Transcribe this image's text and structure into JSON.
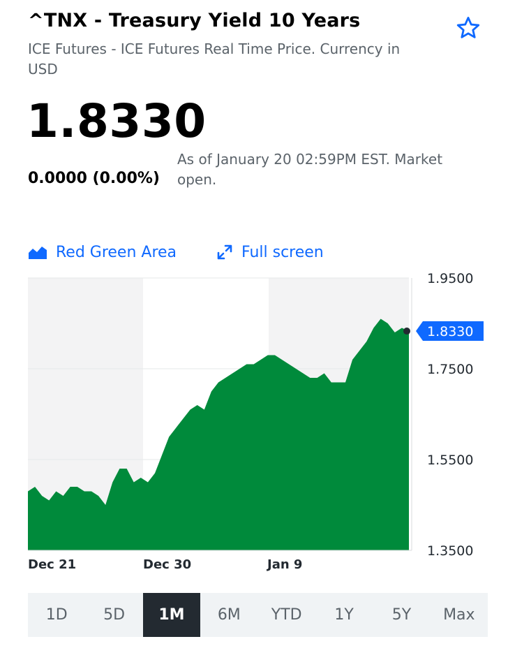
{
  "header": {
    "title": "^TNX - Treasury Yield 10 Years",
    "subtitle": "ICE Futures - ICE Futures Real Time Price. Currency in USD",
    "watchlist_icon": "star-outline-icon"
  },
  "quote": {
    "price": "1.8330",
    "change": "0.0000 (0.00%)",
    "as_of": "As of January 20 02:59PM EST. Market open."
  },
  "chart_controls": {
    "chart_type_icon": "area-chart-icon",
    "chart_type_label": "Red Green Area",
    "fullscreen_icon": "expand-arrows-icon",
    "fullscreen_label": "Full screen"
  },
  "colors": {
    "accent": "#0f69ff",
    "area_fill": "#008a3b",
    "active_range_bg": "#232a31"
  },
  "chart_data": {
    "type": "area",
    "y_ticks": [
      "1.9500",
      "1.7500",
      "1.5500",
      "1.3500"
    ],
    "ylim": [
      1.35,
      1.95
    ],
    "x_ticks": [
      "Dec 21",
      "Dec 30",
      "Jan 9"
    ],
    "current_label": "1.8330",
    "series": [
      {
        "values": [
          1.48,
          1.49,
          1.47,
          1.46,
          1.48,
          1.47,
          1.49,
          1.49,
          1.48,
          1.48,
          1.47,
          1.45,
          1.5,
          1.53,
          1.53,
          1.5,
          1.51,
          1.5,
          1.52,
          1.56,
          1.6,
          1.62,
          1.64,
          1.66,
          1.67,
          1.66,
          1.7,
          1.72,
          1.73,
          1.74,
          1.75,
          1.76,
          1.76,
          1.77,
          1.78,
          1.78,
          1.77,
          1.76,
          1.75,
          1.74,
          1.73,
          1.73,
          1.74,
          1.72,
          1.72,
          1.72,
          1.77,
          1.79,
          1.81,
          1.84,
          1.86,
          1.85,
          1.83,
          1.84,
          1.833
        ]
      }
    ]
  },
  "ranges": [
    "1D",
    "5D",
    "1M",
    "6M",
    "YTD",
    "1Y",
    "5Y",
    "Max"
  ],
  "active_range": "1M"
}
